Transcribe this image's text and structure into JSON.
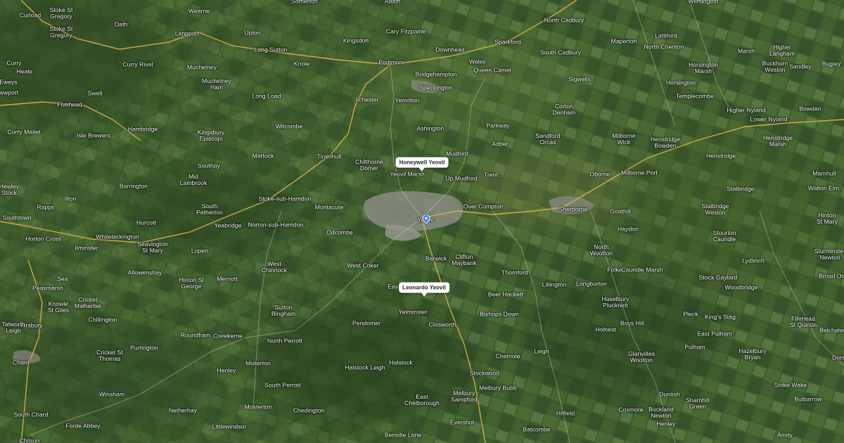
{
  "map": {
    "view": "satellite",
    "colors": {
      "terrain_base": "#3b5a2c",
      "field_light": "#5d7a3e",
      "field_dark": "#2a4420",
      "town": "#8d8f86",
      "road_major": "#e0b44a",
      "road_minor": "#d8d2c0",
      "pin": "#4a7ff5"
    },
    "callouts": [
      {
        "label": "Honeywell Yeovil"
      },
      {
        "label": "Leonardo Yeovil"
      }
    ],
    "pin_icon": "map-pin-icon",
    "places": [
      "Somerton",
      "Adam",
      "Wilmington",
      "Wearne",
      "Curload",
      "Stoke St\nGregory",
      "Stoke St\nGregory",
      "Oath",
      "Langport",
      "Upton",
      "Long Sutton",
      "Kingsdon",
      "Cary Fitzpaine",
      "North Cadbury",
      "Lattiford",
      "Maperton",
      "North Cheriton",
      "Higher\nLangham",
      "Marsh",
      "Buckhorn\nWeston",
      "Sandley",
      "Bugley",
      "Podimore",
      "Downhead",
      "Sparkford",
      "South Cadbury",
      "Wales",
      "Queen Camel",
      "Bridgehampton",
      "Speckington",
      "Yeovilton",
      "Ilchester",
      "Horsington\nMarsh",
      "Horsington",
      "Curry Rivel",
      "Muchelney",
      "Muchelney\nHam",
      "Knole",
      "Long Load",
      "Sigwells",
      "Corton\nDenham",
      "Templecombe",
      "Higher Nyland",
      "Lower Nyland",
      "Bowden",
      "Fivehead",
      "Swell",
      "Curry Mallet",
      "Isle Brewers",
      "Hambridge",
      "Kingsbury\nEpiscopi",
      "Witcombe",
      "Ashington",
      "Parkway",
      "Sandford\nOrcas",
      "Milborne\nWick",
      "Henstridge\nBowden",
      "Henstridge\nMarsh",
      "Henstridge",
      "Martock",
      "Tintinhull",
      "Chilthorne\nDomer",
      "Mudford",
      "Adber",
      "Southay",
      "Mid\nLambrook",
      "Barrington",
      "Yeovil Marsh",
      "Up Mudford",
      "Trent",
      "Oborne",
      "Milborne Port",
      "Marnhull",
      "Stalbridge",
      "Walton Elm",
      "Ilton",
      "South\nPetherton",
      "Stoke-sub-Hamdon",
      "Montacute",
      "Over Compton",
      "Sherborne",
      "Goathill",
      "Stalbridge\nWeston",
      "Hinton\nSt Mary",
      "Rapps",
      "Southtown",
      "Hurcott",
      "Yeabridge",
      "Norton-sub-Hamdon",
      "Odcombe",
      "Yeovil",
      "Haydon",
      "Stourton\nCaundle",
      "Whitelackington",
      "Seavington\nSt Mary",
      "Ilminster",
      "Horton Cross",
      "Lopen",
      "North\nWootton",
      "Folke",
      "Caundle Marsh",
      "Lydlinch",
      "Sturminster\nNewton",
      "Barwick",
      "Clifton\nMaybank",
      "West Coker",
      "West\nChinnock",
      "Allowenshay",
      "Hinton St\nGeorge",
      "Merriott",
      "Thornford",
      "Stock Gaylard",
      "Broad Oak",
      "Sea",
      "Peasmarsh",
      "Knowle\nSt Giles",
      "Cricket\nMalherbie",
      "East",
      "Beer Hackett",
      "Lillington",
      "Longburton",
      "Woodbridge",
      "Haselbury\nPlucknett",
      "Sutton\nBingham",
      "Yetminster",
      "Bishops Down",
      "Chillington",
      "Pendomer",
      "Closworth",
      "Pleck",
      "King's Stag",
      "Fifehead\nSt Quintin",
      "Belchalwell",
      "Horsbury",
      "Tatworth\nLeigh",
      "Roundham",
      "Crewkerne",
      "North Perrott",
      "Holnest",
      "Boys Hill",
      "East Pulham",
      "Purtington",
      "Cricket St\nThomas",
      "Chard",
      "Leigh",
      "Chetnole",
      "Glanvilles\nWootton",
      "Pulham",
      "Hazelbury\nBryan",
      "Henley",
      "Misterton",
      "Halstock Leigh",
      "Halstock",
      "Stockwood",
      "South Perrott",
      "Melbury Bubb",
      "Dorset",
      "Winsham",
      "East\nChelborough",
      "Melbury\nSampford",
      "Duntish",
      "Stoke Wake",
      "Buckland\nNewton",
      "Sharnhill\nGreen",
      "Cosmore",
      "Bulbarrow",
      "South Chard",
      "Netherhay",
      "Mosterton",
      "Chedington",
      "Hilfield",
      "Forde Abbey",
      "Littlewindsor",
      "Evershot",
      "Batcombe",
      "Henley",
      "Benville Lane",
      "Ansty",
      "Chilson",
      "Hewley\nStock",
      "Heale",
      "Eweys",
      "Newport",
      "Curry"
    ]
  }
}
